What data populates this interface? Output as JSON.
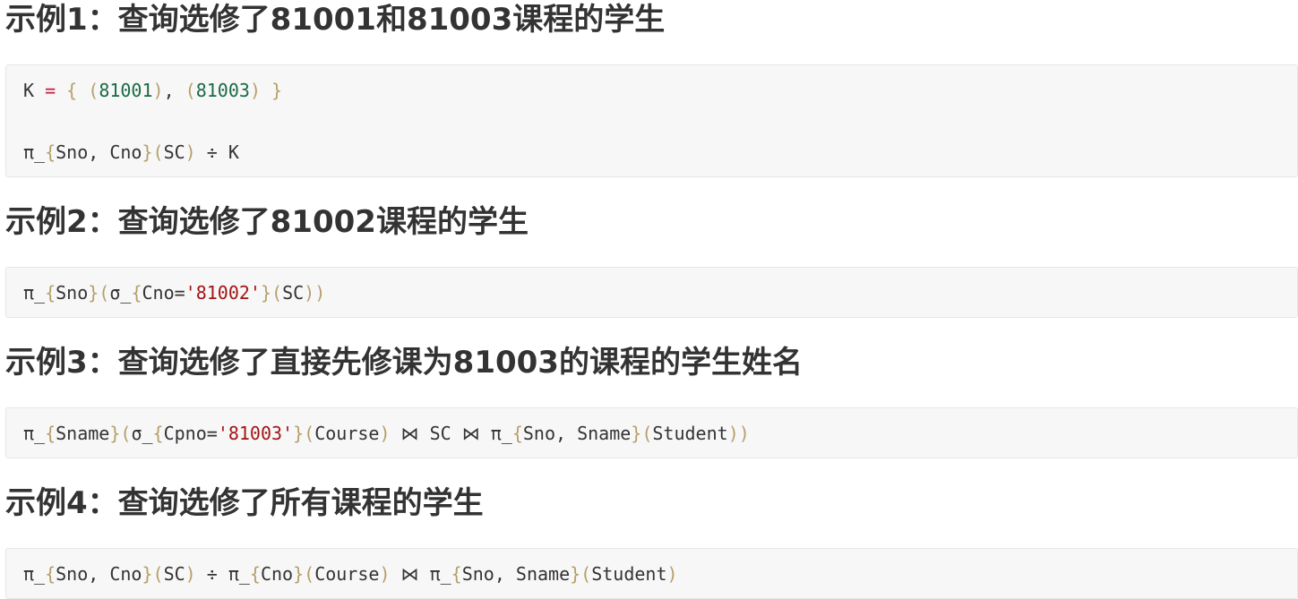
{
  "headings": [
    "示例1：查询选修了81001和81003课程的学生",
    "示例2：查询选修了81002课程的学生",
    "示例3：查询选修了直接先修课为81003的课程的学生姓名",
    "示例4：查询选修了所有课程的学生"
  ],
  "code_blocks": [
    {
      "lines": [
        [
          {
            "t": "K ",
            "c": "plain"
          },
          {
            "t": "=",
            "c": "op"
          },
          {
            "t": " { ",
            "c": "brace"
          },
          {
            "t": "(",
            "c": "brace"
          },
          {
            "t": "81001",
            "c": "num"
          },
          {
            "t": ")",
            "c": "brace"
          },
          {
            "t": ", ",
            "c": "plain"
          },
          {
            "t": "(",
            "c": "brace"
          },
          {
            "t": "81003",
            "c": "num"
          },
          {
            "t": ")",
            "c": "brace"
          },
          {
            "t": " }",
            "c": "brace"
          }
        ],
        [],
        [
          {
            "t": "π_",
            "c": "plain"
          },
          {
            "t": "{",
            "c": "brace"
          },
          {
            "t": "Sno, Cno",
            "c": "plain"
          },
          {
            "t": "}(",
            "c": "brace"
          },
          {
            "t": "SC",
            "c": "plain"
          },
          {
            "t": ")",
            "c": "brace"
          },
          {
            "t": " ÷ K",
            "c": "plain"
          }
        ]
      ]
    },
    {
      "lines": [
        [
          {
            "t": "π_",
            "c": "plain"
          },
          {
            "t": "{",
            "c": "brace"
          },
          {
            "t": "Sno",
            "c": "plain"
          },
          {
            "t": "}(",
            "c": "brace"
          },
          {
            "t": "σ_",
            "c": "plain"
          },
          {
            "t": "{",
            "c": "brace"
          },
          {
            "t": "Cno",
            "c": "plain"
          },
          {
            "t": "=",
            "c": "plain"
          },
          {
            "t": "'81002'",
            "c": "str"
          },
          {
            "t": "}(",
            "c": "brace"
          },
          {
            "t": "SC",
            "c": "plain"
          },
          {
            "t": "))",
            "c": "brace"
          }
        ]
      ]
    },
    {
      "lines": [
        [
          {
            "t": "π_",
            "c": "plain"
          },
          {
            "t": "{",
            "c": "brace"
          },
          {
            "t": "Sname",
            "c": "plain"
          },
          {
            "t": "}(",
            "c": "brace"
          },
          {
            "t": "σ_",
            "c": "plain"
          },
          {
            "t": "{",
            "c": "brace"
          },
          {
            "t": "Cpno",
            "c": "plain"
          },
          {
            "t": "=",
            "c": "plain"
          },
          {
            "t": "'81003'",
            "c": "str"
          },
          {
            "t": "}(",
            "c": "brace"
          },
          {
            "t": "Course",
            "c": "plain"
          },
          {
            "t": ")",
            "c": "brace"
          },
          {
            "t": " ⋈ SC ⋈ π_",
            "c": "plain"
          },
          {
            "t": "{",
            "c": "brace"
          },
          {
            "t": "Sno, Sname",
            "c": "plain"
          },
          {
            "t": "}(",
            "c": "brace"
          },
          {
            "t": "Student",
            "c": "plain"
          },
          {
            "t": "))",
            "c": "brace"
          }
        ]
      ]
    },
    {
      "lines": [
        [
          {
            "t": "π_",
            "c": "plain"
          },
          {
            "t": "{",
            "c": "brace"
          },
          {
            "t": "Sno, Cno",
            "c": "plain"
          },
          {
            "t": "}(",
            "c": "brace"
          },
          {
            "t": "SC",
            "c": "plain"
          },
          {
            "t": ")",
            "c": "brace"
          },
          {
            "t": " ÷ π_",
            "c": "plain"
          },
          {
            "t": "{",
            "c": "brace"
          },
          {
            "t": "Cno",
            "c": "plain"
          },
          {
            "t": "}(",
            "c": "brace"
          },
          {
            "t": "Course",
            "c": "plain"
          },
          {
            "t": ")",
            "c": "brace"
          },
          {
            "t": " ⋈ π_",
            "c": "plain"
          },
          {
            "t": "{",
            "c": "brace"
          },
          {
            "t": "Sno, Sname",
            "c": "plain"
          },
          {
            "t": "}(",
            "c": "brace"
          },
          {
            "t": "Student",
            "c": "plain"
          },
          {
            "t": ")",
            "c": "brace"
          }
        ]
      ]
    }
  ]
}
